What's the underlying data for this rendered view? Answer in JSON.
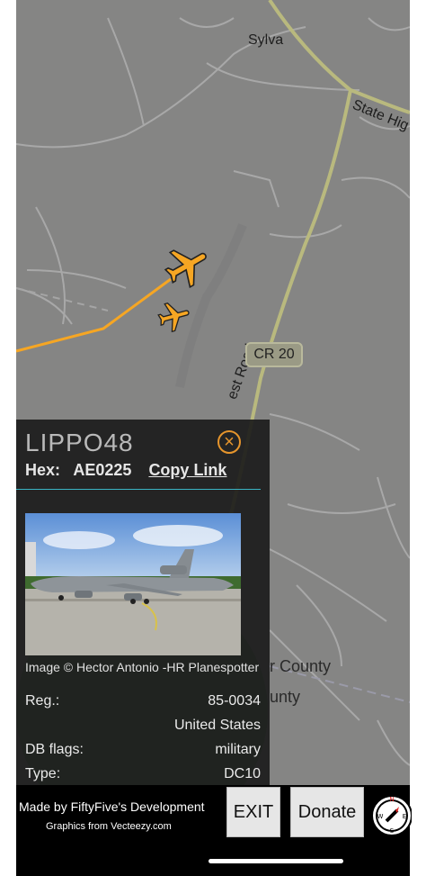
{
  "map": {
    "town_label": "Sylva",
    "road_label_state": "State Hig",
    "road_label_west": "est Road",
    "route_badge": "CR 20",
    "county_label": "r County",
    "county_label_2": "unty"
  },
  "panel": {
    "callsign": "LIPPO48",
    "hex_label": "Hex:",
    "hex_value": "AE0225",
    "copy_link_label": "Copy Link",
    "photo_credit": "Image © Hector Antonio -HR Planespotter",
    "rows": [
      {
        "label": "Reg.:",
        "value": "85-0034"
      },
      {
        "label": "",
        "value": "United States"
      },
      {
        "label": "DB flags:",
        "value": "military"
      },
      {
        "label": "Type:",
        "value": "DC10"
      }
    ]
  },
  "bottom": {
    "developer_credit": "Made by FiftyFive's Development",
    "graphics_credit": "Graphics from Vecteezy.com",
    "exit_label": "EXIT",
    "donate_label": "Donate",
    "compass": {
      "n": "N",
      "s": "S",
      "w": "W",
      "e": "E"
    }
  },
  "colors": {
    "aircraft": "#f6a623",
    "close_accent": "#e6952c",
    "divider": "#3ab4c4"
  },
  "icons": [
    "airplane-icon",
    "close-icon",
    "compass-icon"
  ]
}
